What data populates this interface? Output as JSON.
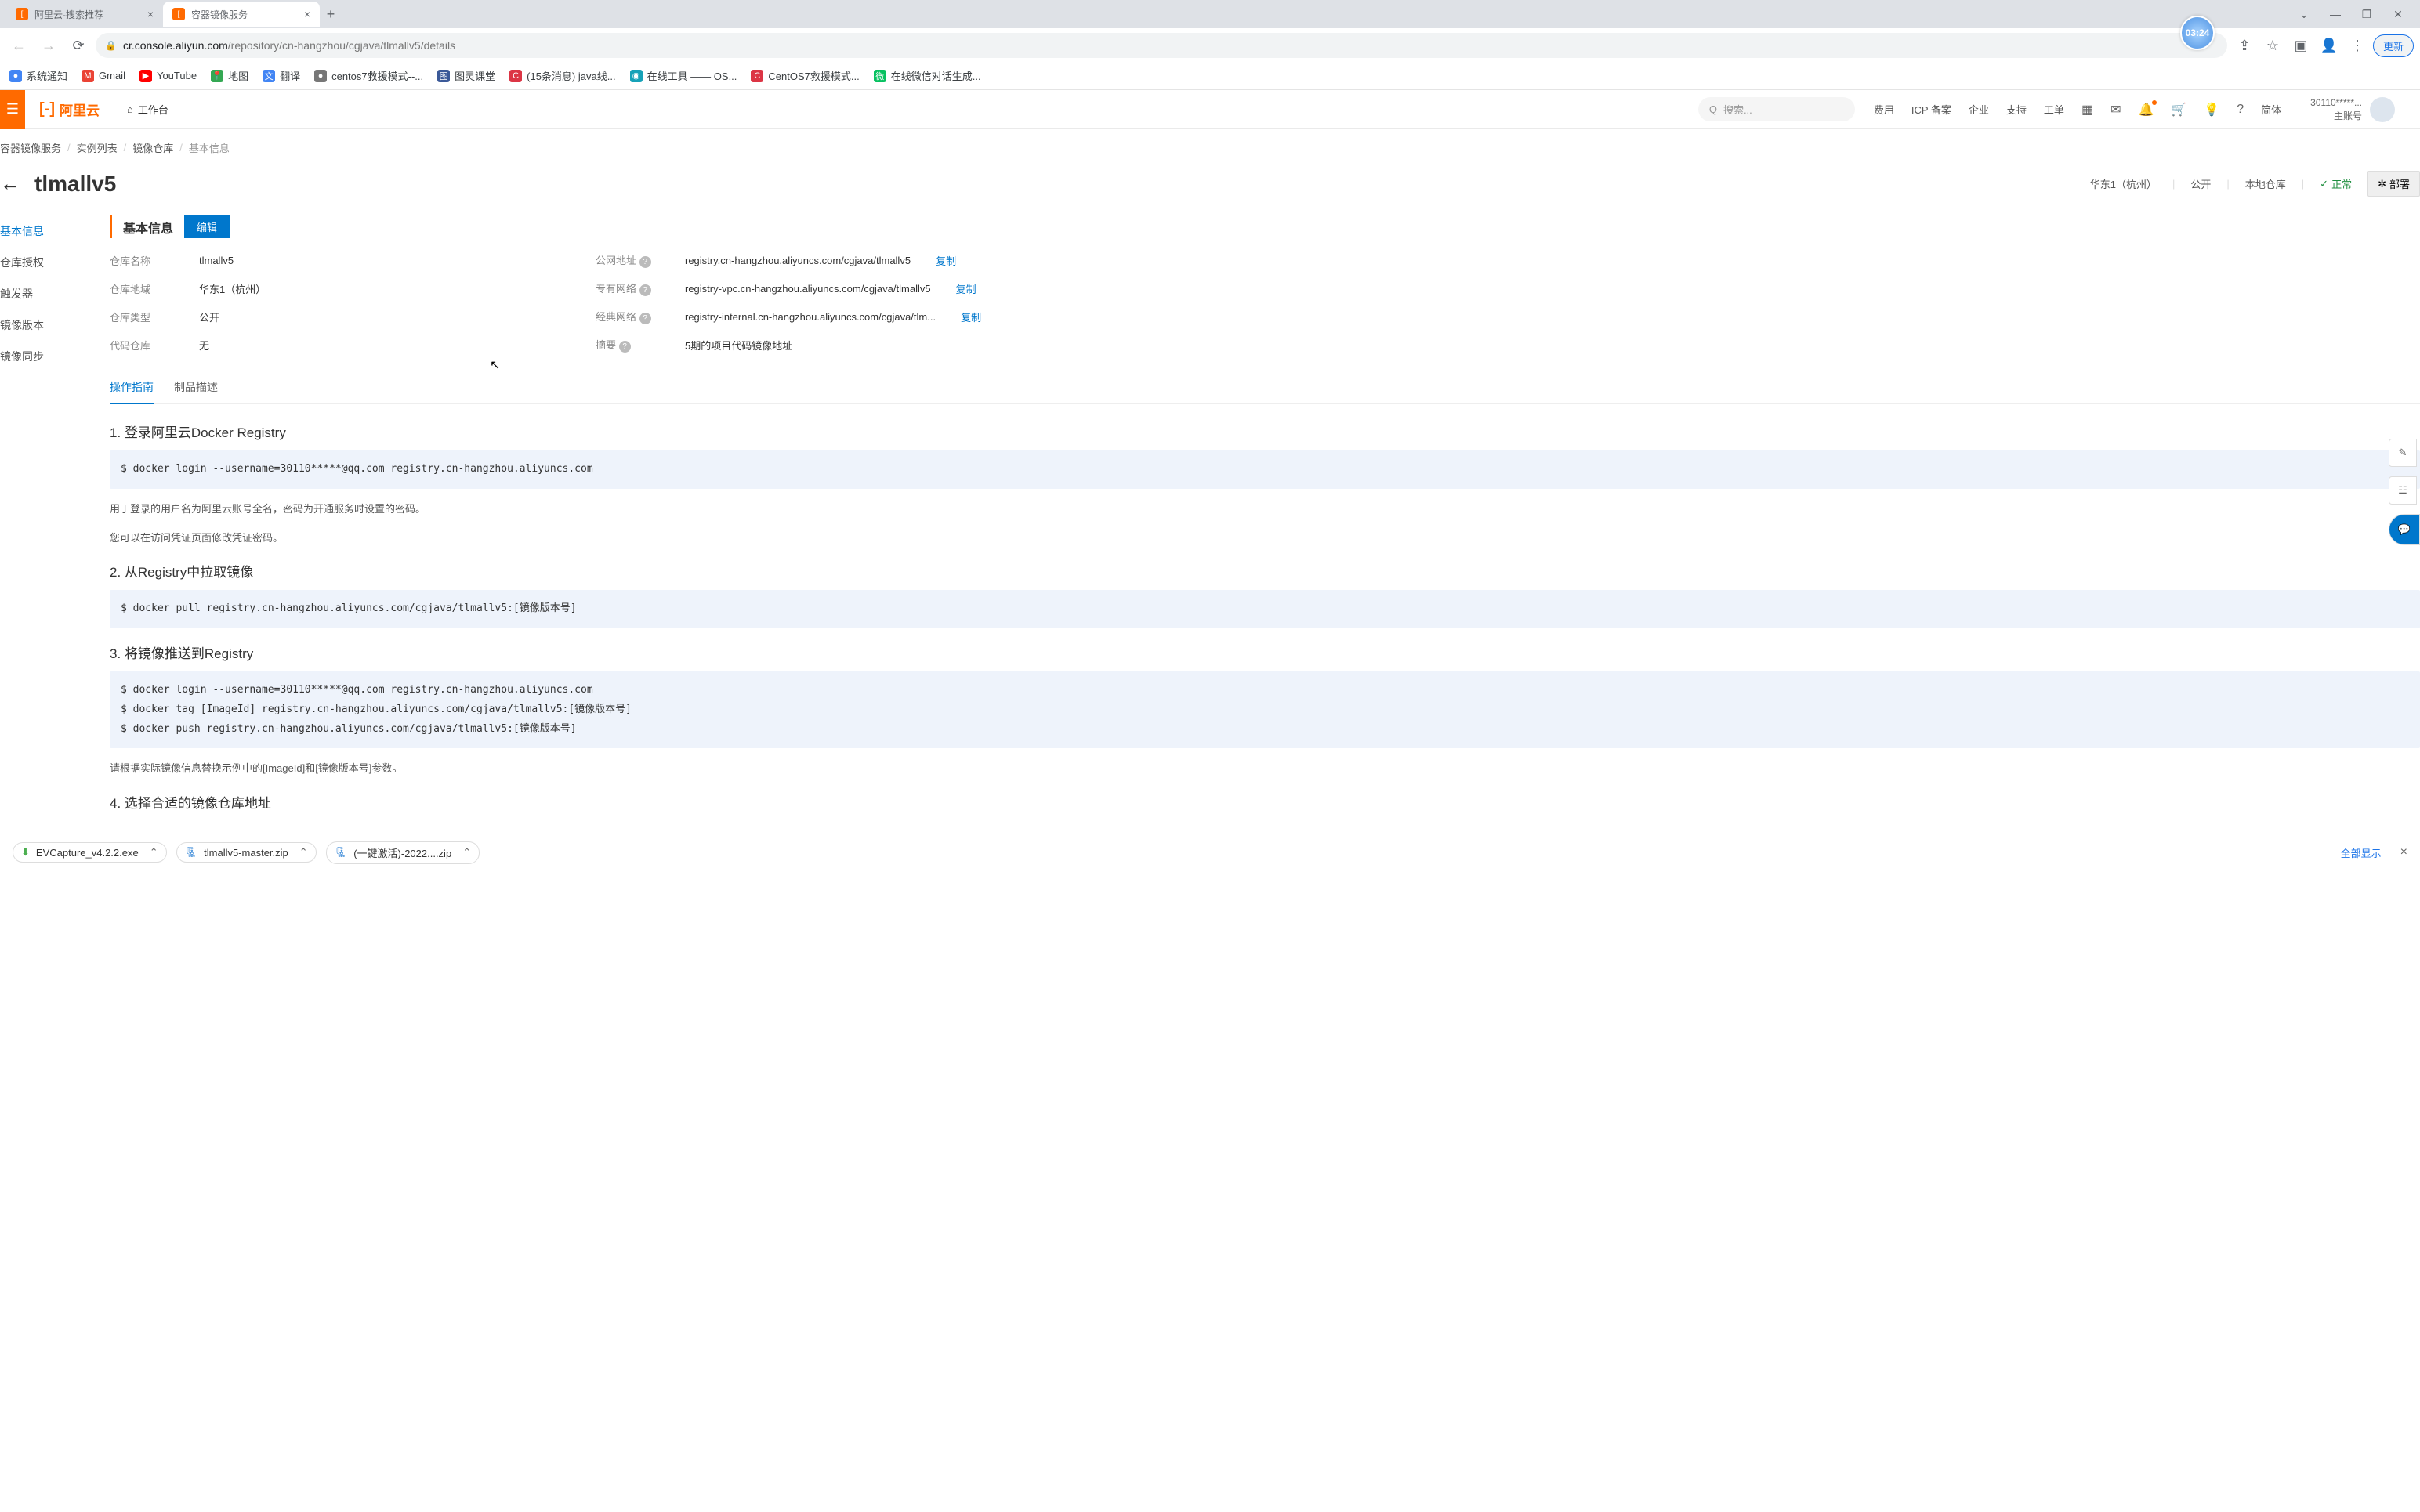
{
  "browser": {
    "tabs": [
      {
        "title": "阿里云-搜索推荐",
        "active": false
      },
      {
        "title": "容器镜像服务",
        "active": true
      }
    ],
    "url_host": "cr.console.aliyun.com",
    "url_path": "/repository/cn-hangzhou/cgjava/tlmallv5/details",
    "time_badge": "03:24",
    "update_btn": "更新",
    "bookmarks": [
      {
        "label": "系统通知",
        "color": "#4285f4"
      },
      {
        "label": "Gmail",
        "color": "#ea4335",
        "glyph": "M"
      },
      {
        "label": "YouTube",
        "color": "#ff0000",
        "glyph": "▶"
      },
      {
        "label": "地图",
        "color": "#34a853",
        "glyph": "📍"
      },
      {
        "label": "翻译",
        "color": "#4285f4",
        "glyph": "文"
      },
      {
        "label": "centos7救援模式--...",
        "color": "#777",
        "glyph": "●"
      },
      {
        "label": "图灵课堂",
        "color": "#3b5998",
        "glyph": "图"
      },
      {
        "label": "(15条消息) java线...",
        "color": "#dc3545",
        "glyph": "C"
      },
      {
        "label": "在线工具 —— OS...",
        "color": "#17a2b8",
        "glyph": "◉"
      },
      {
        "label": "CentOS7救援模式...",
        "color": "#dc3545",
        "glyph": "C"
      },
      {
        "label": "在线微信对话生成...",
        "color": "#07c160",
        "glyph": "微"
      }
    ]
  },
  "topbar": {
    "logo": "阿里云",
    "workbench": "工作台",
    "search_placeholder": "搜索...",
    "links": [
      "费用",
      "ICP 备案",
      "企业",
      "支持",
      "工单"
    ],
    "lang": "简体",
    "user_id": "30110*****...",
    "user_role": "主账号"
  },
  "breadcrumb": [
    "容器镜像服务",
    "实例列表",
    "镜像仓库",
    "基本信息"
  ],
  "page": {
    "title": "tlmallv5",
    "region": "华东1（杭州）",
    "visibility": "公开",
    "repo_kind": "本地仓库",
    "status": "正常",
    "deploy_btn": "部署"
  },
  "sidenav": [
    "基本信息",
    "仓库授权",
    "触发器",
    "镜像版本",
    "镜像同步"
  ],
  "section": {
    "title": "基本信息",
    "edit_btn": "编辑"
  },
  "info_left": [
    {
      "label": "仓库名称",
      "value": "tlmallv5"
    },
    {
      "label": "仓库地域",
      "value": "华东1（杭州）"
    },
    {
      "label": "仓库类型",
      "value": "公开"
    },
    {
      "label": "代码仓库",
      "value": "无"
    }
  ],
  "info_right": [
    {
      "label": "公网地址",
      "help": true,
      "value": "registry.cn-hangzhou.aliyuncs.com/cgjava/tlmallv5",
      "copy": "复制"
    },
    {
      "label": "专有网络",
      "help": true,
      "value": "registry-vpc.cn-hangzhou.aliyuncs.com/cgjava/tlmallv5",
      "copy": "复制"
    },
    {
      "label": "经典网络",
      "help": true,
      "value": "registry-internal.cn-hangzhou.aliyuncs.com/cgjava/tlm...",
      "copy": "复制"
    },
    {
      "label": "摘要",
      "help": true,
      "value": "5期的项目代码镜像地址"
    }
  ],
  "tabs": [
    "操作指南",
    "制品描述"
  ],
  "guide": {
    "step1_title": "1. 登录阿里云Docker Registry",
    "step1_code": "$ docker login --username=30110*****@qq.com registry.cn-hangzhou.aliyuncs.com",
    "step1_note1": "用于登录的用户名为阿里云账号全名，密码为开通服务时设置的密码。",
    "step1_note2": "您可以在访问凭证页面修改凭证密码。",
    "step2_title": "2. 从Registry中拉取镜像",
    "step2_code": "$ docker pull registry.cn-hangzhou.aliyuncs.com/cgjava/tlmallv5:[镜像版本号]",
    "step3_title": "3. 将镜像推送到Registry",
    "step3_code": "$ docker login --username=30110*****@qq.com registry.cn-hangzhou.aliyuncs.com\n$ docker tag [ImageId] registry.cn-hangzhou.aliyuncs.com/cgjava/tlmallv5:[镜像版本号]\n$ docker push registry.cn-hangzhou.aliyuncs.com/cgjava/tlmallv5:[镜像版本号]",
    "step3_note": "请根据实际镜像信息替换示例中的[ImageId]和[镜像版本号]参数。",
    "step4_title": "4. 选择合适的镜像仓库地址"
  },
  "downloads": {
    "items": [
      {
        "name": "EVCapture_v4.2.2.exe",
        "icon": "⬇",
        "color": "#4caf50"
      },
      {
        "name": "tlmallv5-master.zip",
        "icon": "🗜",
        "color": "#1976d2"
      },
      {
        "name": "(一键激活)-2022....zip",
        "icon": "🗜",
        "color": "#1976d2"
      }
    ],
    "show_all": "全部显示"
  }
}
